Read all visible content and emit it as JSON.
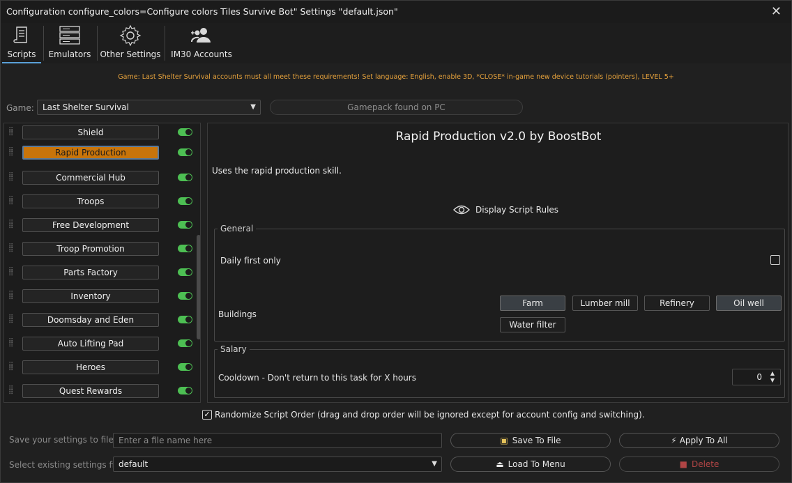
{
  "window": {
    "title": "Configuration configure_colors=Configure colors Tiles Survive Bot\" Settings \"default.json\"",
    "close_icon": "close-icon"
  },
  "tabs": [
    {
      "label": "Scripts",
      "icon": "scroll-icon",
      "active": true
    },
    {
      "label": "Emulators",
      "icon": "server-icon",
      "active": false
    },
    {
      "label": "Other Settings",
      "icon": "gear-icon",
      "active": false
    },
    {
      "label": "IM30 Accounts",
      "icon": "users-icon",
      "active": false
    }
  ],
  "warning": "Game: Last Shelter Survival accounts must all meet these requirements! Set language: English, enable 3D, *CLOSE* in-game new device tutorials (pointers), LEVEL 5+",
  "game": {
    "label": "Game:",
    "selected": "Last Shelter Survival",
    "status": "Gamepack found on PC"
  },
  "scripts": [
    {
      "label": "Shield",
      "selected": false,
      "enabled": true
    },
    {
      "label": "Rapid Production",
      "selected": true,
      "enabled": true
    },
    {
      "label": "Commercial Hub",
      "selected": false,
      "enabled": true
    },
    {
      "label": "Troops",
      "selected": false,
      "enabled": true
    },
    {
      "label": "Free Development",
      "selected": false,
      "enabled": true
    },
    {
      "label": "Troop Promotion",
      "selected": false,
      "enabled": true
    },
    {
      "label": "Parts Factory",
      "selected": false,
      "enabled": true
    },
    {
      "label": "Inventory",
      "selected": false,
      "enabled": true
    },
    {
      "label": "Doomsday and Eden",
      "selected": false,
      "enabled": true
    },
    {
      "label": "Auto Lifting Pad",
      "selected": false,
      "enabled": true
    },
    {
      "label": "Heroes",
      "selected": false,
      "enabled": true
    },
    {
      "label": "Quest Rewards",
      "selected": false,
      "enabled": true
    }
  ],
  "detail": {
    "title": "Rapid Production v2.0 by BoostBot",
    "description": "Uses the rapid production skill.",
    "rules_label": "Display Script Rules",
    "general": {
      "legend": "General",
      "daily_first_only": "Daily first only",
      "daily_checked": false,
      "buildings_label": "Buildings",
      "buildings": [
        {
          "label": "Farm",
          "on": true
        },
        {
          "label": "Lumber mill",
          "on": false
        },
        {
          "label": "Refinery",
          "on": false
        },
        {
          "label": "Oil well",
          "on": true
        },
        {
          "label": "Water filter",
          "on": false
        }
      ]
    },
    "salary": {
      "legend": "Salary",
      "cooldown_label": "Cooldown - Don't return to this task for X hours",
      "cooldown_value": "0"
    }
  },
  "randomize": {
    "label": "Randomize Script Order (drag and drop order will be ignored except for account config and switching).",
    "checked": true
  },
  "save": {
    "label": "Save your settings to file",
    "placeholder": "Enter a file name here",
    "save_button": "Save To File",
    "apply_button": "Apply To All"
  },
  "load": {
    "label": "Select existing settings file",
    "selected": "default",
    "load_button": "Load To Menu",
    "delete_button": "Delete"
  },
  "colors": {
    "accent": "#c8740a",
    "toggle_on": "#4dbf53",
    "warning": "#e6a23c",
    "delete": "#b04545"
  }
}
